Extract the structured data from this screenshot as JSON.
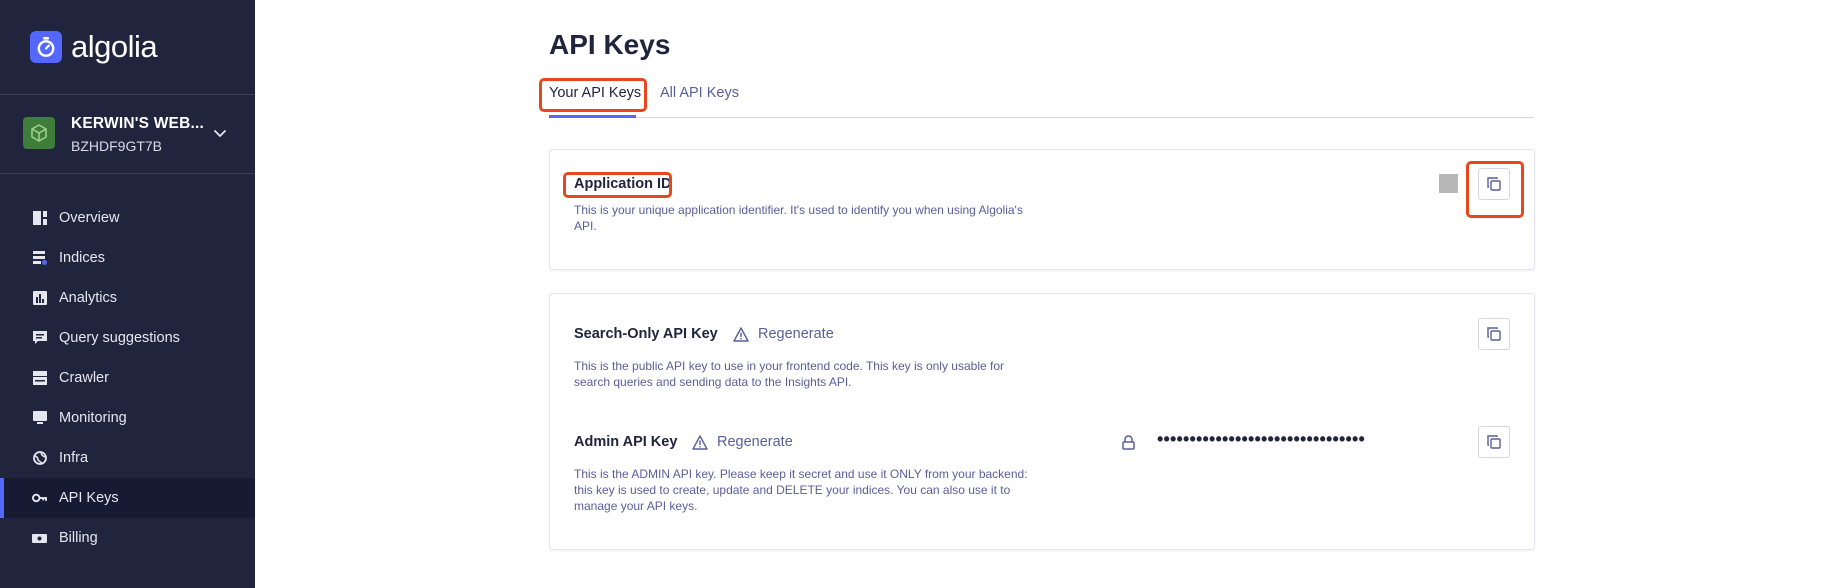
{
  "brand": {
    "name": "algolia",
    "accent": "#5468ff",
    "sidebar_bg": "#21243d",
    "highlight": "#e8471e"
  },
  "app_switcher": {
    "name": "KERWIN'S WEB...",
    "id": "BZHDF9GT7B",
    "icon": "cube-icon"
  },
  "sidebar": {
    "items": [
      {
        "label": "Overview",
        "icon": "overview-icon"
      },
      {
        "label": "Indices",
        "icon": "indices-icon"
      },
      {
        "label": "Analytics",
        "icon": "analytics-icon"
      },
      {
        "label": "Query suggestions",
        "icon": "query-suggestions-icon"
      },
      {
        "label": "Crawler",
        "icon": "crawler-icon"
      },
      {
        "label": "Monitoring",
        "icon": "monitoring-icon"
      },
      {
        "label": "Infra",
        "icon": "infra-icon"
      },
      {
        "label": "API Keys",
        "icon": "key-icon",
        "active": true
      },
      {
        "label": "Billing",
        "icon": "billing-icon"
      }
    ]
  },
  "page": {
    "title": "API Keys",
    "tabs": [
      {
        "label": "Your API Keys",
        "selected": true
      },
      {
        "label": "All API Keys",
        "selected": false
      }
    ]
  },
  "application_id": {
    "label": "Application ID",
    "description": "This is your unique application identifier. It's used to identify you when using Algolia's API."
  },
  "search_key": {
    "label": "Search-Only API Key",
    "regenerate": "Regenerate",
    "description": "This is the public API key to use in your frontend code. This key is only usable for search queries and sending data to the Insights API."
  },
  "admin_key": {
    "label": "Admin API Key",
    "regenerate": "Regenerate",
    "masked_value": "••••••••••••••••••••••••••••••••",
    "description": "This is the ADMIN API key. Please keep it secret and use it ONLY from your backend: this key is used to create, update and DELETE your indices. You can also use it to manage your API keys."
  }
}
